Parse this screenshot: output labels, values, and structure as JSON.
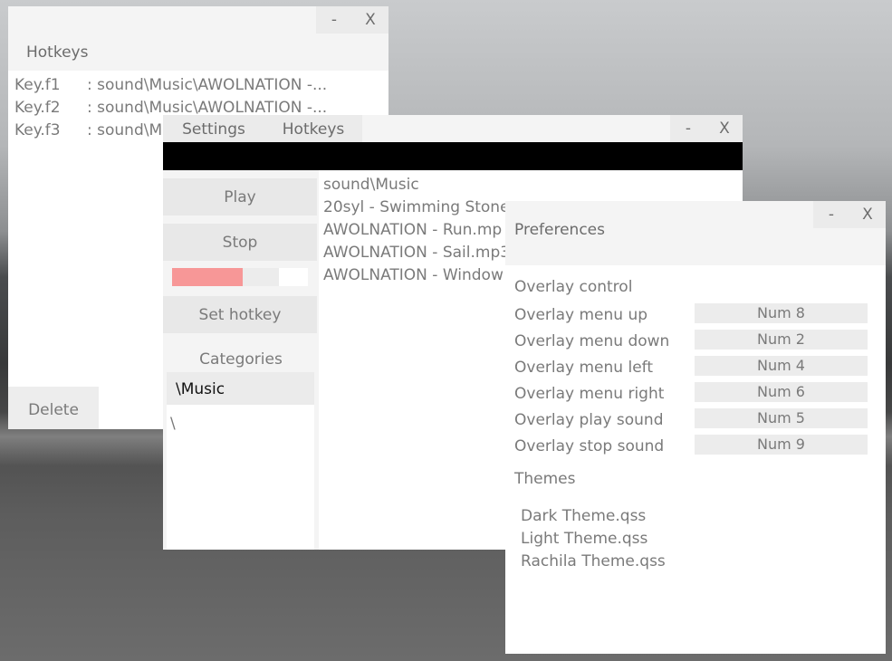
{
  "window_controls": {
    "minimize": "-",
    "close": "X"
  },
  "hotkeys_window": {
    "header": "Hotkeys",
    "rows": [
      {
        "key": "Key.f1",
        "value": ": sound\\Music\\AWOLNATION -..."
      },
      {
        "key": "Key.f2",
        "value": ": sound\\Music\\AWOLNATION -..."
      },
      {
        "key": "Key.f3",
        "value": ": sound\\M"
      }
    ],
    "delete_label": "Delete"
  },
  "main_window": {
    "tabs": [
      "Settings",
      "Hotkeys"
    ],
    "buttons": {
      "play": "Play",
      "stop": "Stop",
      "set_hotkey": "Set hotkey"
    },
    "volume": 0.52,
    "categories_label": "Categories",
    "categories": [
      "\\Music",
      "\\"
    ],
    "files": [
      "sound\\Music",
      "20syl - Swimming Stone",
      "AWOLNATION - Run.mp",
      "AWOLNATION - Sail.mp3",
      "AWOLNATION - Window"
    ]
  },
  "preferences_window": {
    "title": "Preferences",
    "overlay_header": "Overlay control",
    "overlay": [
      {
        "label": "Overlay menu up",
        "key": "Num 8"
      },
      {
        "label": "Overlay menu down",
        "key": "Num 2"
      },
      {
        "label": "Overlay menu left",
        "key": "Num 4"
      },
      {
        "label": "Overlay menu right",
        "key": "Num 6"
      },
      {
        "label": "Overlay play sound",
        "key": "Num 5"
      },
      {
        "label": "Overlay stop sound",
        "key": "Num 9"
      }
    ],
    "themes_header": "Themes",
    "themes": [
      "Dark Theme.qss",
      "Light Theme.qss",
      "Rachila Theme.qss"
    ]
  },
  "colors": {
    "volume_fill": "#f79797",
    "title_bar": "#f4f4f4",
    "button": "#e8e8e8",
    "black_bar": "#000000"
  }
}
